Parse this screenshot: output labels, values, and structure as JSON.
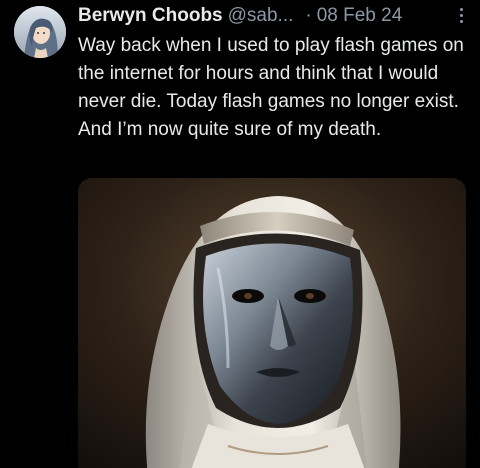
{
  "tweet": {
    "author_name": "Berwyn Choobs",
    "author_handle": "@sab...",
    "separator": "·",
    "date": "08 Feb 24",
    "text": "Way back when I used to play flash games on the internet for hours and think that I would never die. Today flash games no longer exist. And I’m now quite sure of my death."
  },
  "icons": {
    "more": "more-vertical-icon",
    "avatar": "avatar-anime-portrait"
  },
  "colors": {
    "background": "#000000",
    "primary_text": "#e7e9ea",
    "secondary_text": "#8b98a5"
  }
}
